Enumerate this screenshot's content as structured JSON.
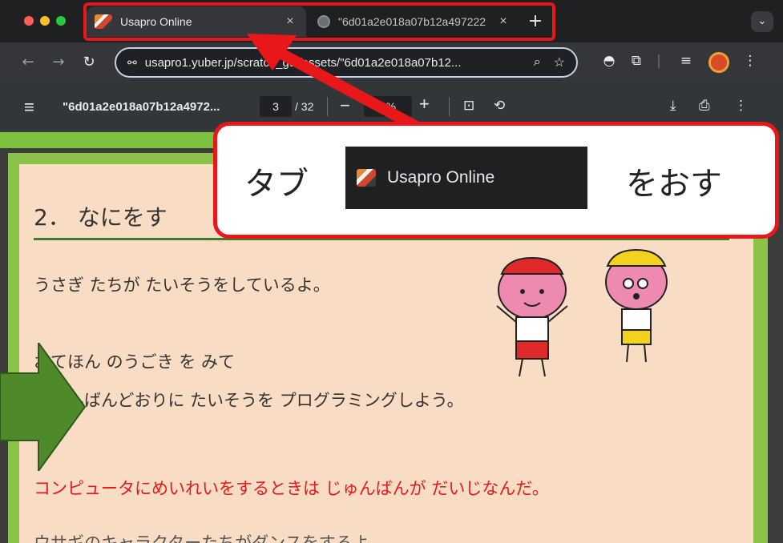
{
  "browser": {
    "tabs": [
      {
        "title": "Usapro Online",
        "active": true,
        "close": "×"
      },
      {
        "title": "\"6d01a2e018a07b12a497222",
        "active": false,
        "close": "×"
      }
    ],
    "new_tab": "+",
    "tabs_menu": "⌄",
    "url": "usapro1.yuber.jp/scratch_gui/assets/\"6d01a2e018a07b12...",
    "tune_icon": "⚙",
    "icons": [
      "back-icon",
      "forward-icon",
      "reload-icon",
      "zoom-icon",
      "star-icon",
      "extension-icon",
      "puzzle-icon",
      "media-icon",
      "profile-icon",
      "kebab-menu-icon"
    ]
  },
  "pdf_viewer": {
    "title": "\"6d01a2e018a07b12a4972...",
    "page": "3",
    "total": "/ 32",
    "zoom": "78%",
    "minus": "−",
    "plus": "+"
  },
  "callout": {
    "before": "タブ",
    "tab_label": "Usapro Online",
    "after": "をおす"
  },
  "content": {
    "heading": "2． なにをす",
    "line1": "うさぎ たちが たいそうをしているよ。",
    "line2": "おてほん のうごき を みて",
    "line3": "じゅんばんどおりに たいそうを プログラミングしよう。",
    "line4": "コンピュータにめいれいをするときは じゅんばんが だいじなんだ。",
    "line5": "ウサギのキャラクターたちがダンスをするよ"
  },
  "colors": {
    "accent_red": "#e8181a",
    "page_green": "#8bc34a",
    "page_bg": "#f8dcc3",
    "arrow_green": "#4f8a2a"
  }
}
